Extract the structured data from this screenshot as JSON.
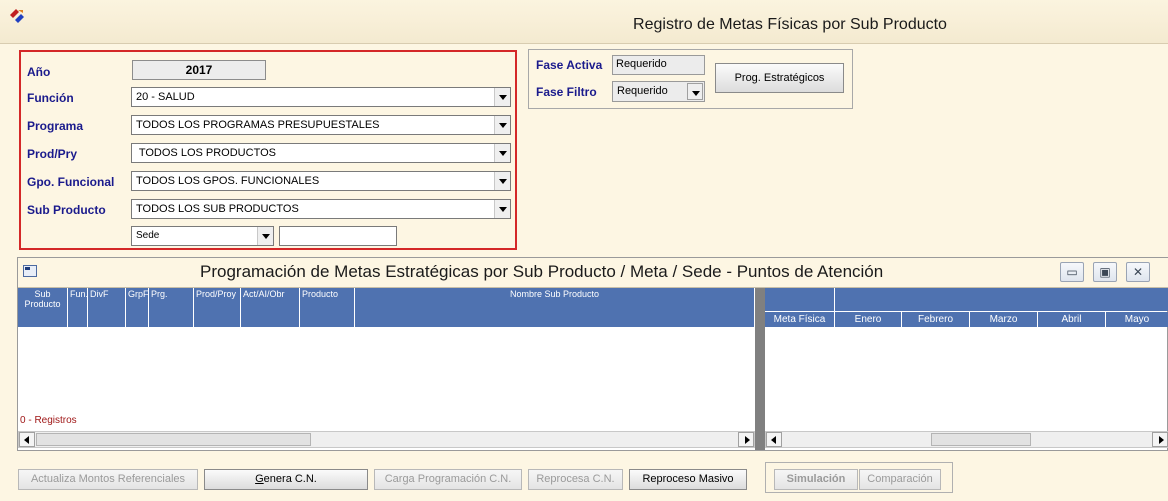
{
  "window": {
    "title": "Registro de Metas Físicas por Sub Producto"
  },
  "filters": {
    "year_label": "Año",
    "year_value": "2017",
    "funcion_label": "Función",
    "funcion_value": "20 - SALUD",
    "programa_label": "Programa",
    "programa_value": "TODOS LOS PROGRAMAS PRESUPUESTALES",
    "prodpry_label": "Prod/Pry",
    "prodpry_value": " TODOS LOS PRODUCTOS",
    "gpo_label": "Gpo. Funcional",
    "gpo_value": "TODOS LOS GPOS. FUNCIONALES",
    "subproducto_label": "Sub Producto",
    "subproducto_value": "TODOS LOS SUB PRODUCTOS",
    "sede_value": "Sede",
    "sede_text": ""
  },
  "fase": {
    "activa_label": "Fase Activa",
    "activa_value": "Requerido",
    "filtro_label": "Fase Filtro",
    "filtro_value": "Requerido",
    "prog_button": "Prog. Estratégicos"
  },
  "grid": {
    "title": "Programación de Metas Estratégicas por Sub Producto / Meta / Sede - Puntos de Atención",
    "left_columns": [
      "Sub Producto",
      "Fun.",
      "DivF",
      "GrpF",
      "Prg.",
      "Prod/Proy",
      "Act/AI/Obr",
      "Producto",
      "Nombre Sub Producto"
    ],
    "right_columns": [
      "Meta Física",
      "Enero",
      "Febrero",
      "Marzo",
      "Abril",
      "Mayo"
    ],
    "records_label": "0 - Registros",
    "win_buttons": [
      "▭",
      "▣",
      "✕"
    ]
  },
  "buttons": {
    "actualiza": "Actualiza Montos Referenciales",
    "genera_prefix": "G",
    "genera_rest": "enera C.N.",
    "carga": "Carga Programación C.N.",
    "reprocesa": "Reprocesa C.N.",
    "reproceso_masivo": "Reproceso Masivo",
    "simulacion": "Simulación",
    "comparacion": "Comparación"
  },
  "colors": {
    "header_blue": "#4f72b0",
    "label_blue": "#1a1a8c",
    "highlight_red": "#d42828",
    "background": "#fdf6e3"
  }
}
